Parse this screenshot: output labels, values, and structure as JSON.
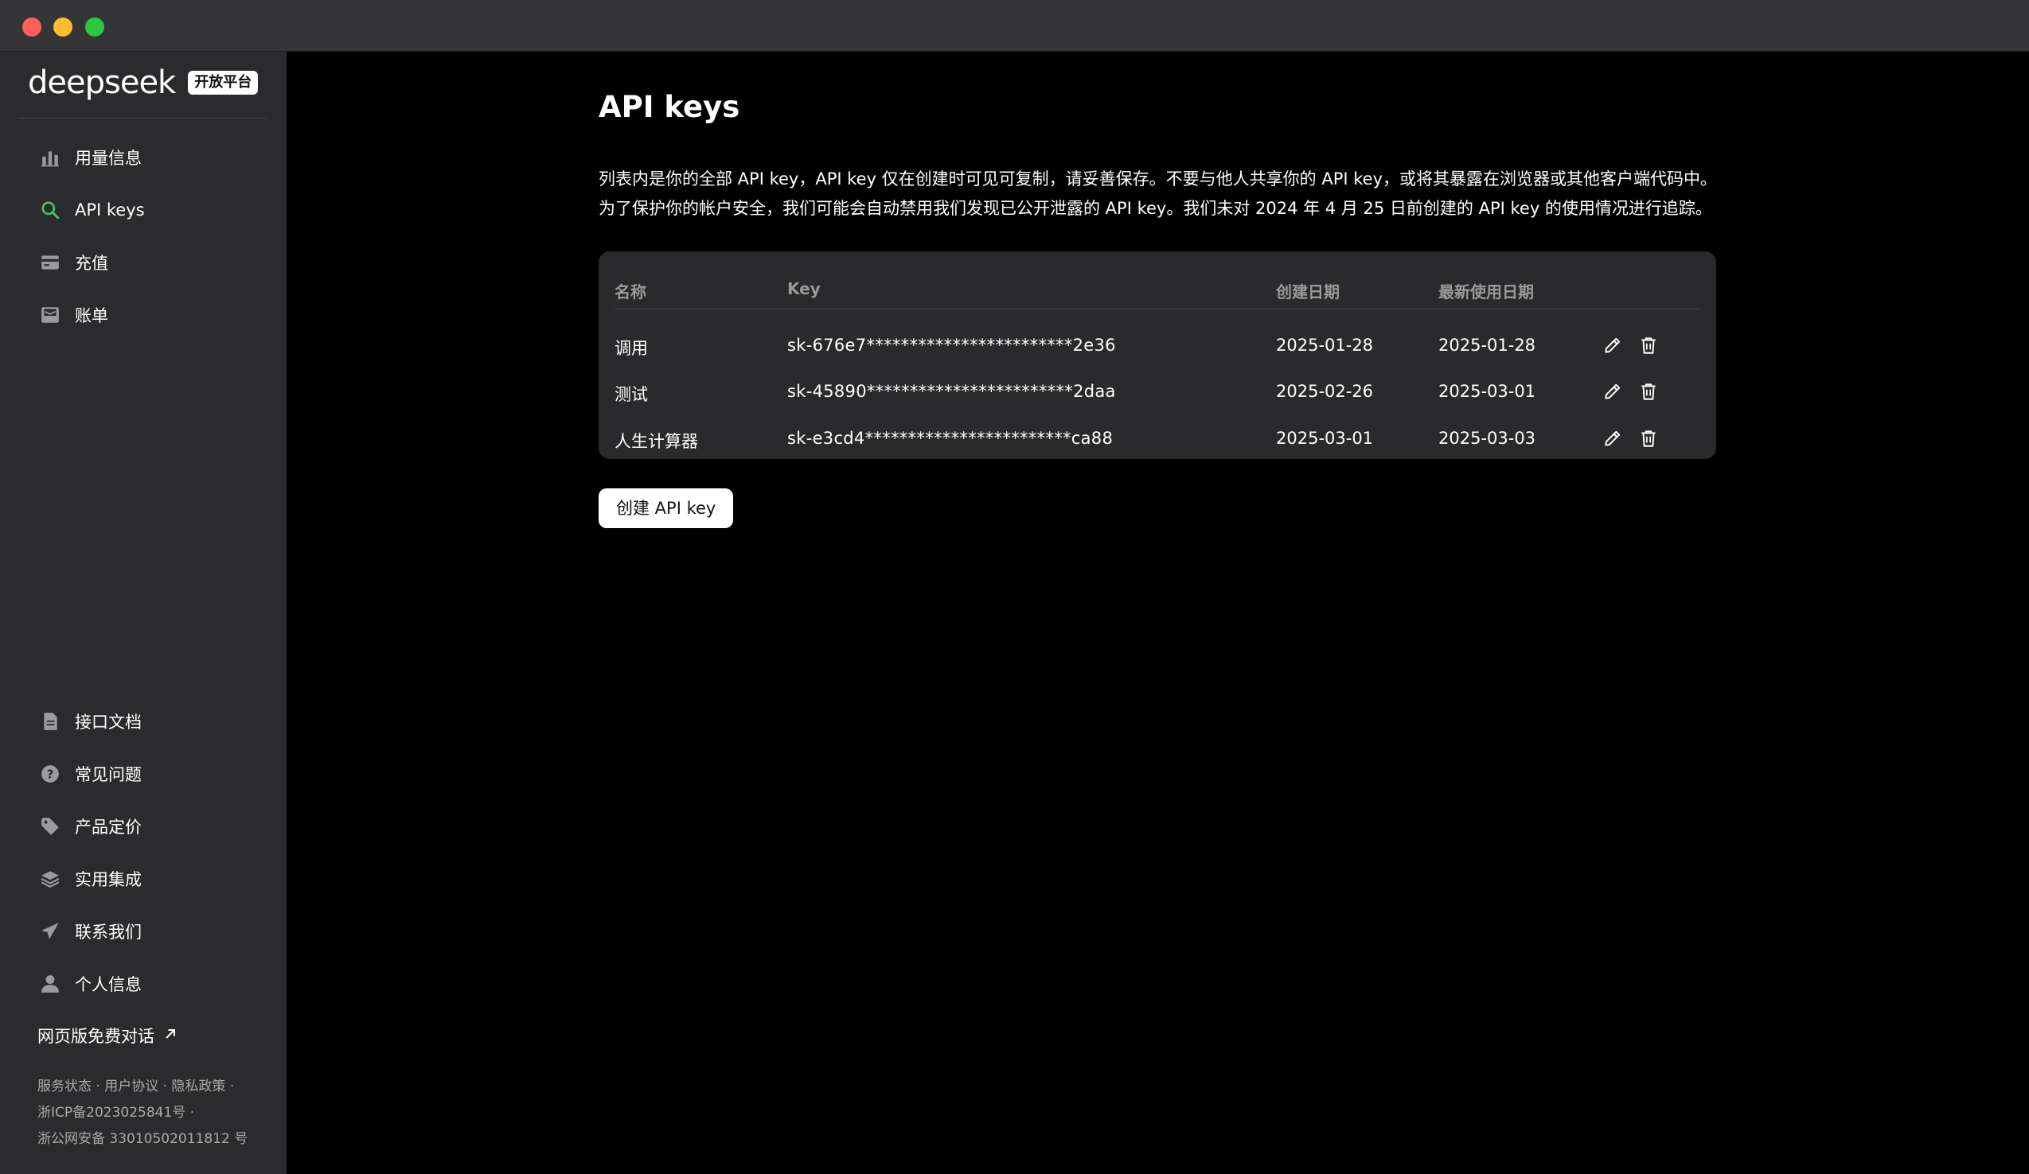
{
  "brand": {
    "wordmark": "deepseek",
    "badge": "开放平台"
  },
  "sidebar": {
    "top_items": [
      {
        "label": "用量信息",
        "icon": "bar-chart-icon"
      },
      {
        "label": "API keys",
        "icon": "search-key-icon",
        "active": true
      },
      {
        "label": "充值",
        "icon": "wallet-icon"
      },
      {
        "label": "账单",
        "icon": "bill-inbox-icon"
      }
    ],
    "bottom_items": [
      {
        "label": "接口文档",
        "icon": "document-icon"
      },
      {
        "label": "常见问题",
        "icon": "question-icon"
      },
      {
        "label": "产品定价",
        "icon": "price-tag-icon"
      },
      {
        "label": "实用集成",
        "icon": "layers-icon"
      },
      {
        "label": "联系我们",
        "icon": "send-icon"
      },
      {
        "label": "个人信息",
        "icon": "user-icon"
      }
    ],
    "web_chat_link": "网页版免费对话",
    "footer": {
      "line1": "服务状态 · 用户协议 · 隐私政策 ·",
      "line2": "浙ICP备2023025841号 ·",
      "line3": "浙公网安备 33010502011812 号"
    }
  },
  "main": {
    "title": "API keys",
    "description_line1": "列表内是你的全部 API key，API key 仅在创建时可见可复制，请妥善保存。不要与他人共享你的 API key，或将其暴露在浏览器或其他客户端代码中。",
    "description_line2": "为了保护你的帐户安全，我们可能会自动禁用我们发现已公开泄露的 API key。我们未对 2024 年 4 月 25 日前创建的 API key 的使用情况进行追踪。",
    "table": {
      "headers": {
        "name": "名称",
        "key": "Key",
        "created": "创建日期",
        "last_used": "最新使用日期"
      },
      "rows": [
        {
          "name": "调用",
          "key": "sk-676e7************************2e36",
          "created": "2025-01-28",
          "last_used": "2025-01-28"
        },
        {
          "name": "测试",
          "key": "sk-45890************************2daa",
          "created": "2025-02-26",
          "last_used": "2025-03-01"
        },
        {
          "name": "人生计算器",
          "key": "sk-e3cd4************************ca88",
          "created": "2025-03-01",
          "last_used": "2025-03-03"
        }
      ]
    },
    "create_button": "创建 API key"
  },
  "colors": {
    "accent_green": "#3bbf6e",
    "sidebar_bg": "#2b2b2d",
    "main_bg": "#000000",
    "card_bg": "#2a2a2c"
  }
}
